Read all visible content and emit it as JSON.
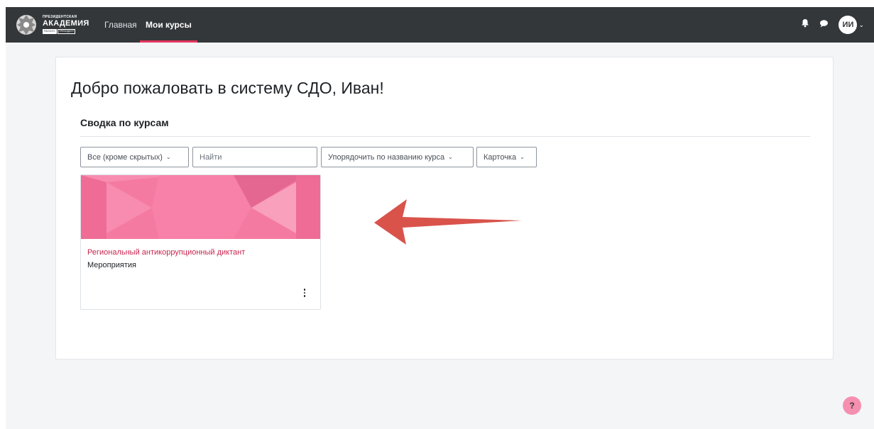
{
  "navbar": {
    "logo": {
      "line1": "ПРЕЗИДЕНТСКАЯ",
      "line2": "АКАДЕМИЯ",
      "sub1": "РАНХИГС",
      "sub2": "ПРЕЗИДЕНТ"
    },
    "links": [
      {
        "label": "Главная",
        "active": false
      },
      {
        "label": "Мои курсы",
        "active": true
      }
    ],
    "avatar_initials": "ИИ",
    "bell_icon": "bell-icon",
    "messages_icon": "chat-bubble-icon"
  },
  "main": {
    "welcome": "Добро пожаловать в систему СДО, Иван!",
    "section_title": "Сводка по курсам",
    "filters": {
      "grouping": "Все (кроме скрытых)",
      "search_placeholder": "Найти",
      "sort": "Упорядочить по названию курса",
      "view": "Карточка"
    },
    "courses": [
      {
        "name": "Региональный антикоррупционный диктант",
        "category": "Мероприятия"
      }
    ]
  },
  "help_label": "?",
  "colors": {
    "navbar": "#33373a",
    "accent": "#e8365e",
    "course_image": "#f57aa2",
    "course_link": "#c7254e",
    "annotation_arrow": "#d9534b"
  }
}
